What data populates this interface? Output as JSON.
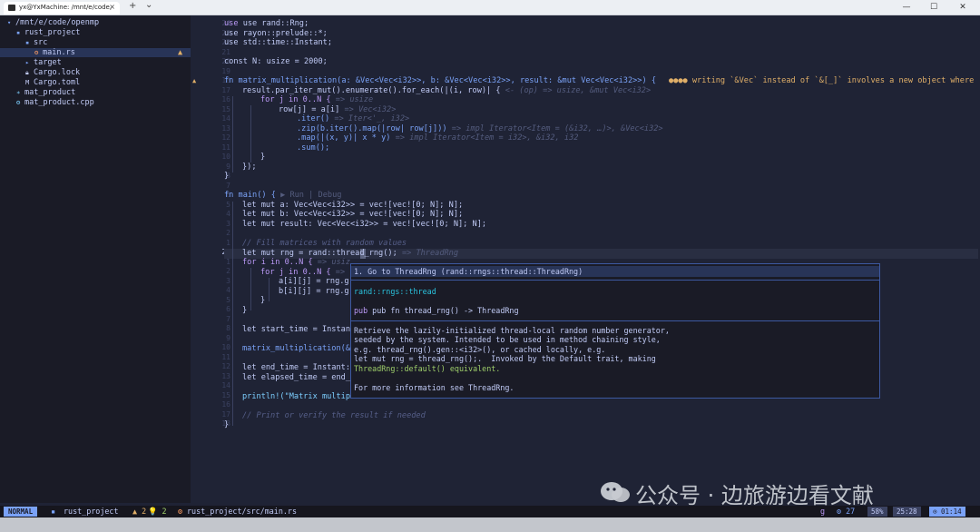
{
  "window": {
    "tab_title": "yx@YxMachine: /mnt/e/code,",
    "close": "×",
    "new_tab": "+",
    "dropdown": "⌄",
    "minimize": "—",
    "maximize": "☐",
    "close_window": "✕"
  },
  "sidebar": {
    "root": "/mnt/e/code/openmp",
    "items": [
      {
        "label": "rust_project",
        "icon": "folder-open-icon"
      },
      {
        "label": "src",
        "icon": "folder-open-icon"
      },
      {
        "label": "main.rs",
        "icon": "rust-file-icon",
        "badge": "▲"
      },
      {
        "label": "target",
        "icon": "folder-icon"
      },
      {
        "label": "Cargo.lock",
        "icon": "lock-icon"
      },
      {
        "label": "Cargo.toml",
        "icon": "toml-icon"
      },
      {
        "label": "mat_product",
        "icon": "binary-icon"
      },
      {
        "label": "mat_product.cpp",
        "icon": "cpp-file-icon"
      }
    ]
  },
  "editor": {
    "line_numbers": [
      "24",
      "23",
      "22",
      "21",
      "20",
      "19",
      "18",
      "17",
      "16",
      "15",
      "14",
      "13",
      "12",
      "11",
      "10",
      "9",
      "8",
      "7",
      "6",
      "5",
      "4",
      "3",
      "2",
      "1",
      "25",
      "1",
      "2",
      "3",
      "4",
      "5",
      "6",
      "7",
      "8",
      "9",
      "10",
      "11",
      "12",
      "13",
      "14",
      "15",
      "16",
      "17",
      "18"
    ],
    "warning_marker": "▲",
    "code": {
      "use1": "use rand::Rng;",
      "use2": "use rayon::prelude::*;",
      "use3": "use std::time::Instant;",
      "const": "const N: usize = 2000;",
      "fn_sig": "fn matrix_multiplication(a: &Vec<Vec<i32>>, b: &Vec<Vec<i32>>, result: &mut Vec<Vec<i32>>) {",
      "diag": "●●●● writing `&Vec` instead of `&[_]` involves a new object where",
      "par_iter": "result.par_iter_mut().enumerate().for_each(|(i, row)| {",
      "par_iter_hint": "<- (op) => usize, &mut Vec<i32>",
      "for_j": "for j in 0..N {",
      "for_j_hint": "=> usize",
      "row_j": "row[j] = a[i]",
      "row_j_hint": "=> Vec<i32>",
      "iter": ".iter()",
      "iter_hint": "=> Iter<'_, i32>",
      "zip": ".zip(b.iter().map(|row| row[j]))",
      "zip_hint": "=> impl Iterator<Item = (&i32, …)>, &Vec<i32>",
      "map": ".map(|(x, y)| x * y)",
      "map_hint": "=> impl Iterator<Item = i32>, &i32, i32",
      "sum": ".sum();",
      "close1": "}",
      "close2": "});",
      "close3": "}",
      "main_sig": "fn main() {",
      "codelens_run": "▶ Run",
      "codelens_sep": "|",
      "codelens_debug": "Debug",
      "let_a": "let mut a: Vec<Vec<i32>> = vec![vec![0; N]; N];",
      "let_b": "let mut b: Vec<Vec<i32>> = vec![vec![0; N]; N];",
      "let_result": "let mut result: Vec<Vec<i32>> = vec![vec![0; N]; N];",
      "comment_fill": "// Fill matrices with random values",
      "let_rng": "let mut rng = rand::thread_rng();",
      "rng_hint": "=> ThreadRng",
      "for_i": "for i in 0..N {",
      "for_i_hint": "=> usiz",
      "for_j2": "for j in 0..N {",
      "for_j2_hint": "=>",
      "aij": "a[i][j] = rng.g",
      "bij": "b[i][j] = rng.g",
      "close4": "}",
      "close5": "}",
      "start_time": "let start_time = Instan",
      "mm_call": "matrix_multiplication(&",
      "end_time": "let end_time = Instant:",
      "elapsed": "let elapsed_time = end_",
      "println": "println!(\"Matrix multip",
      "comment_print": "// Print or verify the result if needed",
      "close6": "}"
    }
  },
  "popup": {
    "goto": "1. Go to ThreadRng (rand::rngs::thread::ThreadRng)",
    "module": "rand::rngs::thread",
    "signature": "pub fn thread_rng() -> ThreadRng",
    "doc1": "Retrieve the lazily-initialized thread-local random number generator,",
    "doc2": "seeded by the system. Intended to be used in method chaining style,",
    "doc3": "e.g. thread_rng().gen::<i32>(), or cached locally, e.g.",
    "doc4": "let mut rng = thread_rng();.  Invoked by the Default trait, making",
    "doc5": "ThreadRng::default() equivalent.",
    "doc6": "For more information see ThreadRng."
  },
  "status": {
    "mode": "NORMAL",
    "project": "rust_project",
    "warnings": "▲ 2",
    "hints": "💡 2",
    "path": "rust_project/src/main.rs",
    "git": "g",
    "lsp": "⚙ 27",
    "percent": "58%",
    "position": "25:28",
    "time": "⊙ 01:14"
  },
  "watermark": {
    "text": "公众号 · 边旅游边看文献"
  }
}
